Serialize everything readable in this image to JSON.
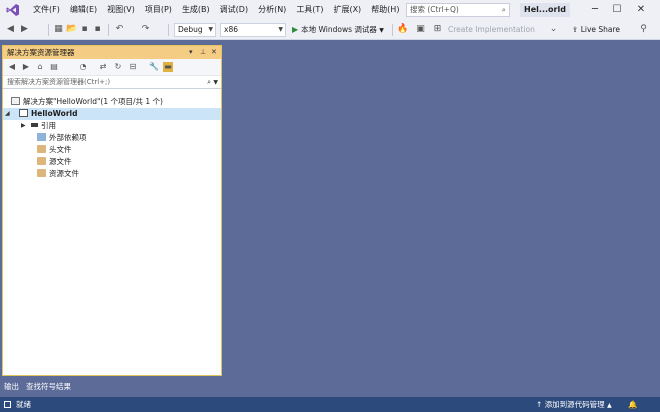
{
  "menubar": {
    "items": [
      "文件(F)",
      "编辑(E)",
      "视图(V)",
      "项目(P)",
      "生成(B)",
      "调试(D)",
      "分析(N)",
      "工具(T)",
      "扩展(X)",
      "帮助(H)"
    ],
    "search_placeholder": "搜索 (Ctrl+Q)",
    "project_badge": "Hel...orld"
  },
  "toolbar": {
    "config": "Debug",
    "platform": "x86",
    "run_label": "本地 Windows 调试器",
    "create_impl": "Create Implementation",
    "live_share": "Live Share"
  },
  "solution_explorer": {
    "title": "解决方案资源管理器",
    "search_placeholder": "搜索解决方案资源管理器(Ctrl+;)",
    "solution_label": "解决方案\"HelloWorld\"(1 个项目/共 1 个)",
    "project_label": "HelloWorld",
    "children": [
      "引用",
      "外部依赖项",
      "头文件",
      "源文件",
      "资源文件"
    ]
  },
  "bottom_tabs": [
    "输出",
    "查找符号结果"
  ],
  "status": {
    "left": "就绪",
    "right": "添加到源代码管理"
  },
  "colors": {
    "workspace": "#5d6b99",
    "panel_header": "#f5cc84",
    "status_bar": "#2d4a7c",
    "selection": "#cce4f7"
  }
}
